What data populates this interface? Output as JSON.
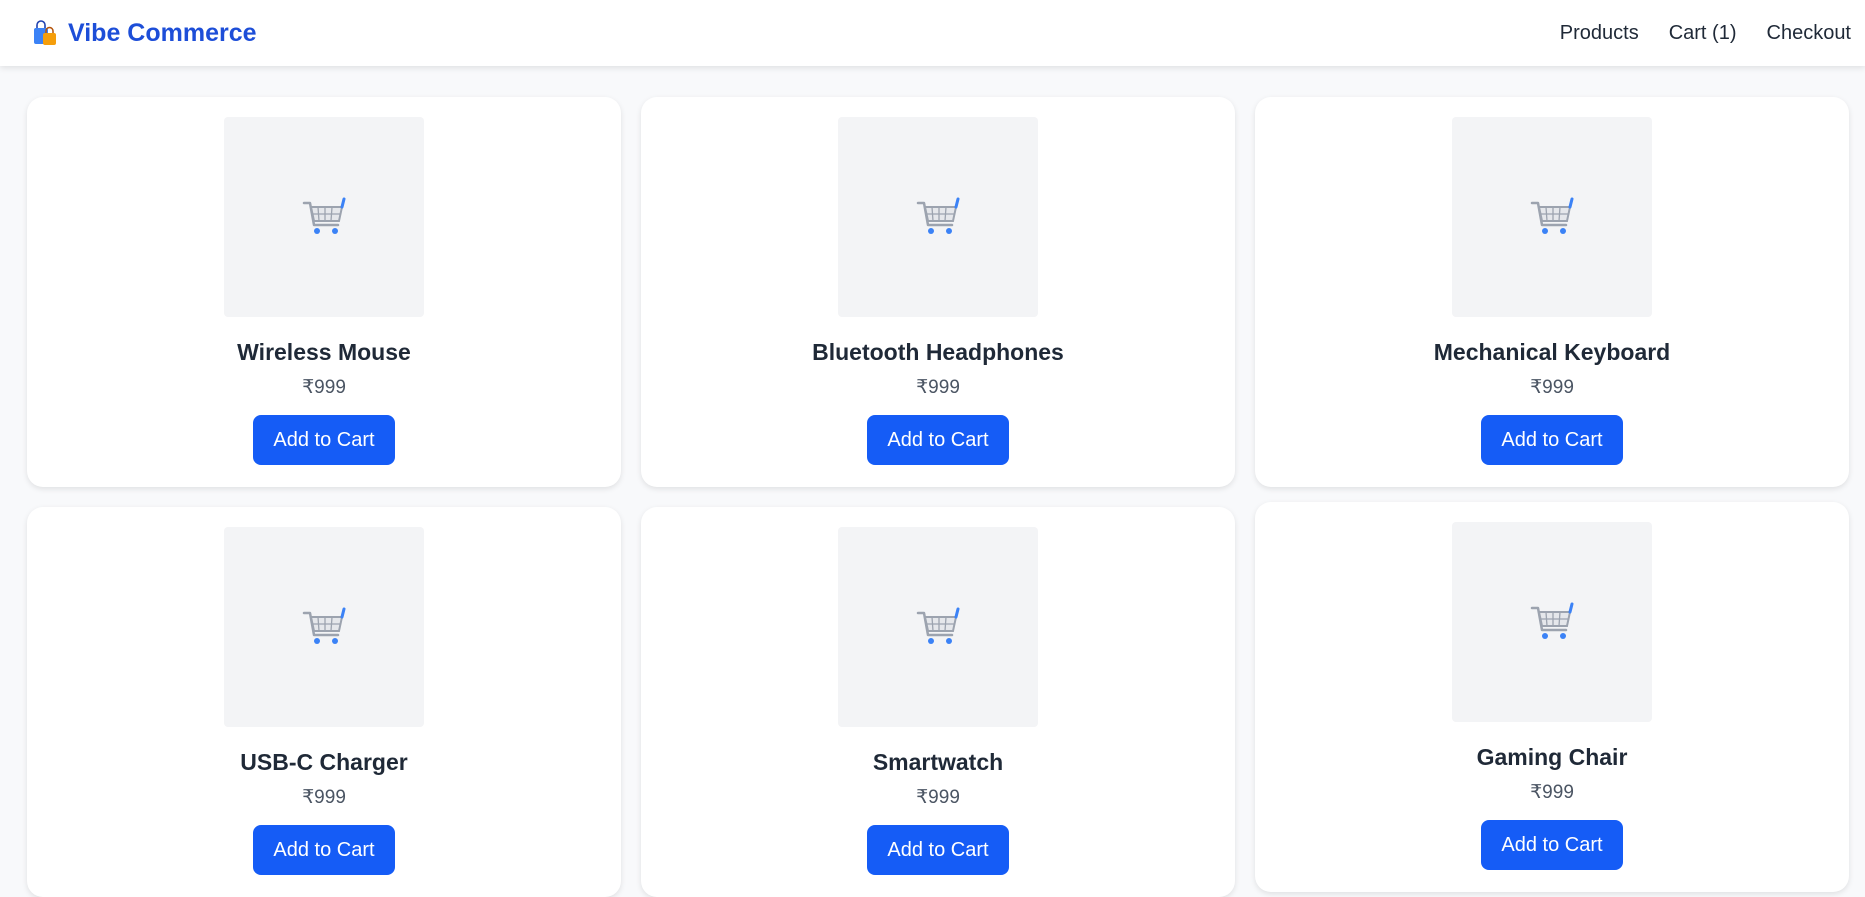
{
  "header": {
    "logo_icon": "shopping-bags-icon",
    "brand": "Vibe Commerce",
    "nav": [
      "Products",
      "Cart (1)",
      "Checkout"
    ]
  },
  "products": [
    {
      "name": "Wireless Mouse",
      "price": "₹999",
      "button": "Add to Cart",
      "icon": "shopping-cart-icon"
    },
    {
      "name": "Bluetooth Headphones",
      "price": "₹999",
      "button": "Add to Cart",
      "icon": "shopping-cart-icon"
    },
    {
      "name": "Mechanical Keyboard",
      "price": "₹999",
      "button": "Add to Cart",
      "icon": "shopping-cart-icon"
    },
    {
      "name": "USB-C Charger",
      "price": "₹999",
      "button": "Add to Cart",
      "icon": "shopping-cart-icon"
    },
    {
      "name": "Smartwatch",
      "price": "₹999",
      "button": "Add to Cart",
      "icon": "shopping-cart-icon"
    },
    {
      "name": "Gaming Chair",
      "price": "₹999",
      "button": "Add to Cart",
      "icon": "shopping-cart-icon"
    }
  ],
  "colors": {
    "brand": "#1d4ed8",
    "button": "#155cf6",
    "page_background": "#f8f9fb",
    "thumbnail_background": "#f3f4f6"
  }
}
